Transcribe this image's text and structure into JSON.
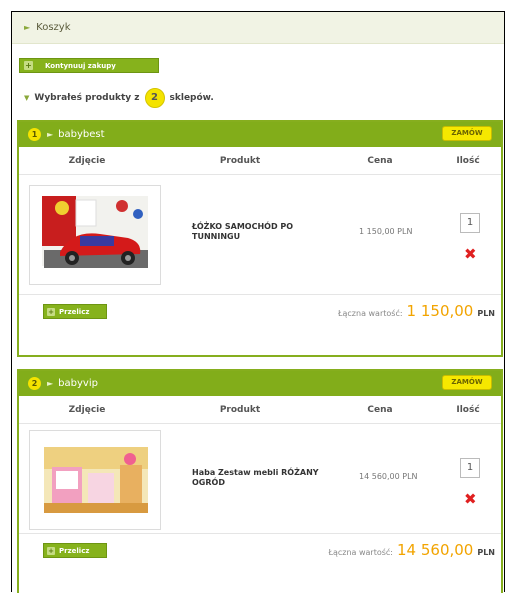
{
  "breadcrumb": {
    "label": "Koszyk"
  },
  "actions": {
    "continue_label": "Kontynuuj zakupy"
  },
  "info": {
    "prefix": "Wybrałeś produkty z",
    "count": "2",
    "suffix": "sklepów."
  },
  "columns": {
    "photo": "Zdjęcie",
    "product": "Produkt",
    "price": "Cena",
    "qty": "Ilość"
  },
  "shops": [
    {
      "number": "1",
      "name": "babybest",
      "order_label": "ZAMÓW",
      "item": {
        "name": "ŁÓŻKO SAMOCHÓD PO TUNNINGU",
        "price": "1 150,00 PLN",
        "qty": "1"
      },
      "recalc_label": "Przelicz",
      "total_label": "Łączna wartość:",
      "total_amount": "1 150,00",
      "currency": "PLN"
    },
    {
      "number": "2",
      "name": "babyvip",
      "order_label": "ZAMÓW",
      "item": {
        "name": "Haba Zestaw mebli RÓŻANY OGRÓD",
        "price": "14 560,00 PLN",
        "qty": "1"
      },
      "recalc_label": "Przelicz",
      "total_label": "Łączna wartość:",
      "total_amount": "14 560,00",
      "currency": "PLN"
    }
  ],
  "colors": {
    "green": "#82ad1a",
    "yellow": "#f4e300",
    "orange": "#f2a400",
    "delete_red": "#e02020"
  },
  "icons": {
    "delete": "delete-x-icon",
    "plus": "plus-icon",
    "arrow": "arrow-right-icon"
  }
}
